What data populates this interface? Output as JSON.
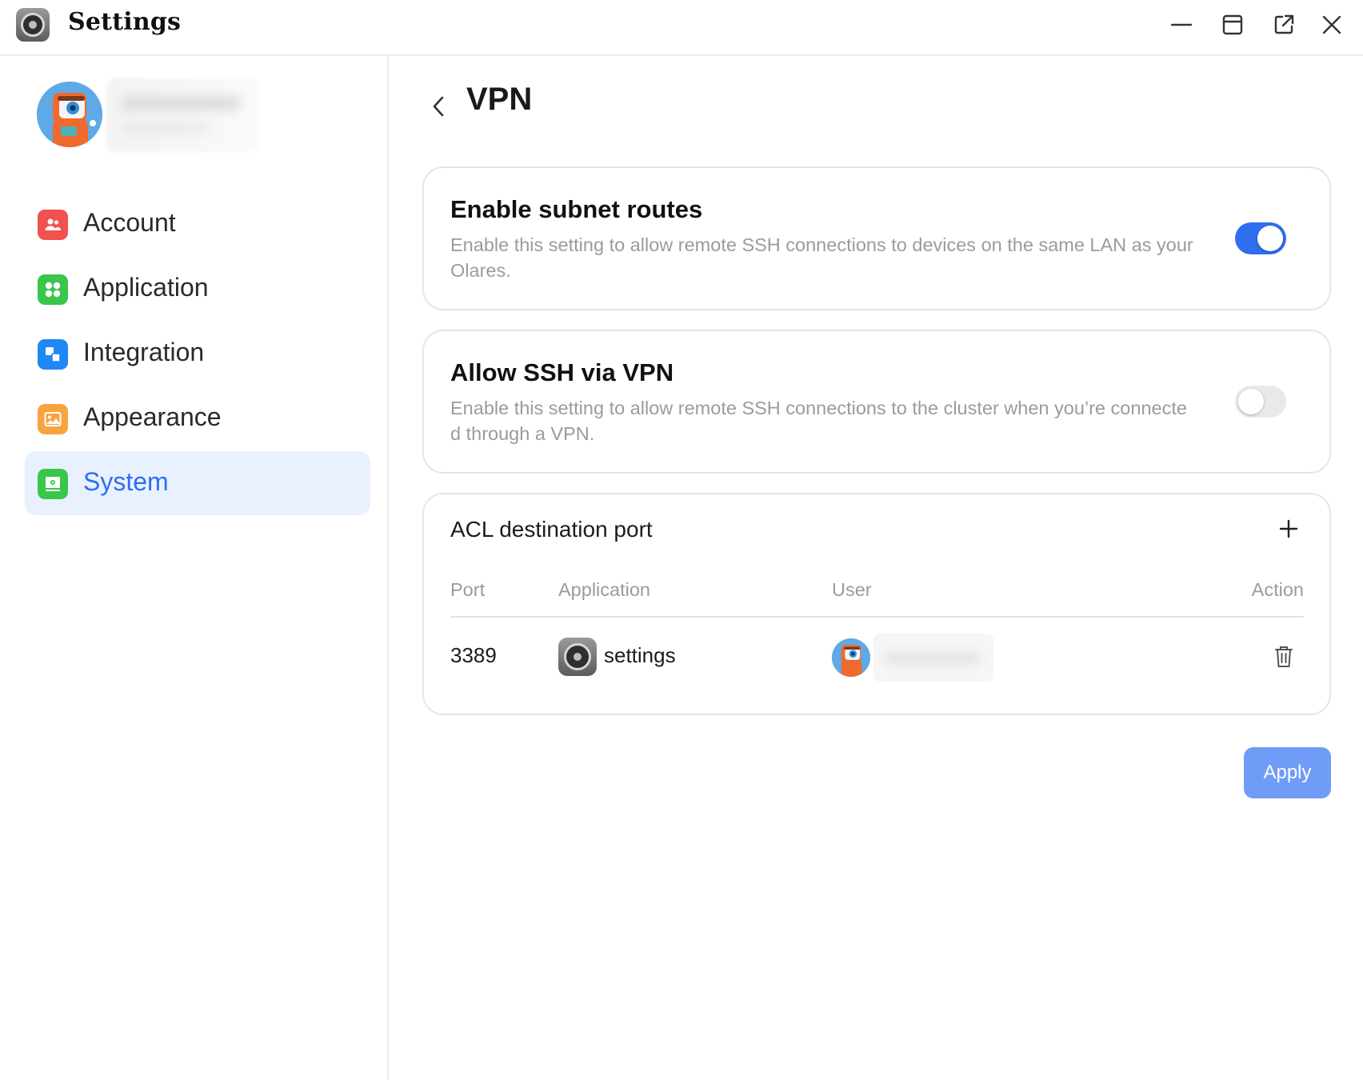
{
  "window": {
    "title": "Settings",
    "icon": "settings-gear-icon",
    "controls": [
      "minimize-icon",
      "maximize-icon",
      "popout-icon",
      "close-icon"
    ]
  },
  "sidebar": {
    "profile": {
      "avatar": "robot-avatar",
      "name_blurred": true
    },
    "items": [
      {
        "label": "Account",
        "icon": "account-icon",
        "color": "#f0524f",
        "active": false
      },
      {
        "label": "Application",
        "icon": "application-icon",
        "color": "#3ac64a",
        "active": false
      },
      {
        "label": "Integration",
        "icon": "integration-icon",
        "color": "#1e88f5",
        "active": false
      },
      {
        "label": "Appearance",
        "icon": "appearance-icon",
        "color": "#f7a43f",
        "active": false
      },
      {
        "label": "System",
        "icon": "system-icon",
        "color": "#3ac64a",
        "active": true
      }
    ]
  },
  "page": {
    "title": "VPN",
    "subnet": {
      "title": "Enable subnet routes",
      "description": "Enable this setting to allow remote SSH connections to devices on the same LAN as your Olares.",
      "enabled": true
    },
    "ssh": {
      "title": "Allow SSH via VPN",
      "description": "Enable this setting to allow remote SSH connections to the cluster when you’re connected through a VPN.",
      "enabled": false
    },
    "acl": {
      "title": "ACL destination port",
      "headers": {
        "port": "Port",
        "application": "Application",
        "user": "User",
        "action": "Action"
      },
      "rows": [
        {
          "port": "3389",
          "application": "settings",
          "app_icon": "settings-gear-icon",
          "user_avatar": "robot-avatar",
          "user_blurred": true,
          "action_icon": "trash-icon"
        }
      ]
    },
    "apply_label": "Apply"
  },
  "colors": {
    "accent": "#2f6ef0",
    "active_nav_bg": "#e9f1fe",
    "apply_button": "#6f9cf6",
    "muted_text": "#9b9b9b"
  }
}
